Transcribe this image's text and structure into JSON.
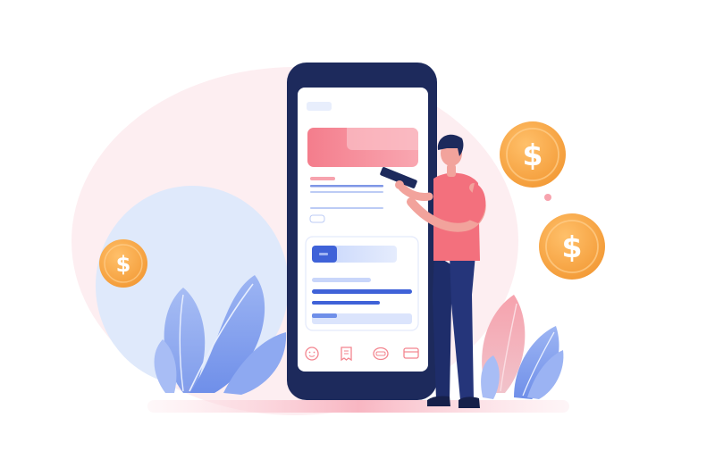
{
  "phone": {
    "status_chip": "",
    "nav_icons": [
      "face-icon",
      "receipt-icon",
      "message-icon",
      "card-icon"
    ]
  },
  "coins": [
    {
      "symbol": "$"
    },
    {
      "symbol": "$"
    },
    {
      "symbol": "$"
    }
  ],
  "colors": {
    "background_blob": "#fdeef1",
    "blue_blob": "#dfe9fb",
    "phone_frame": "#1d2a5c",
    "screen": "#ffffff",
    "accent_pink": "#f7808f",
    "accent_blue": "#3f62d8",
    "coin_orange": "#f6a948",
    "leaf_blue": "#7f9ff0",
    "leaf_pink": "#f59aa5",
    "shirt": "#f3707d",
    "pants": "#1e2d6a"
  }
}
